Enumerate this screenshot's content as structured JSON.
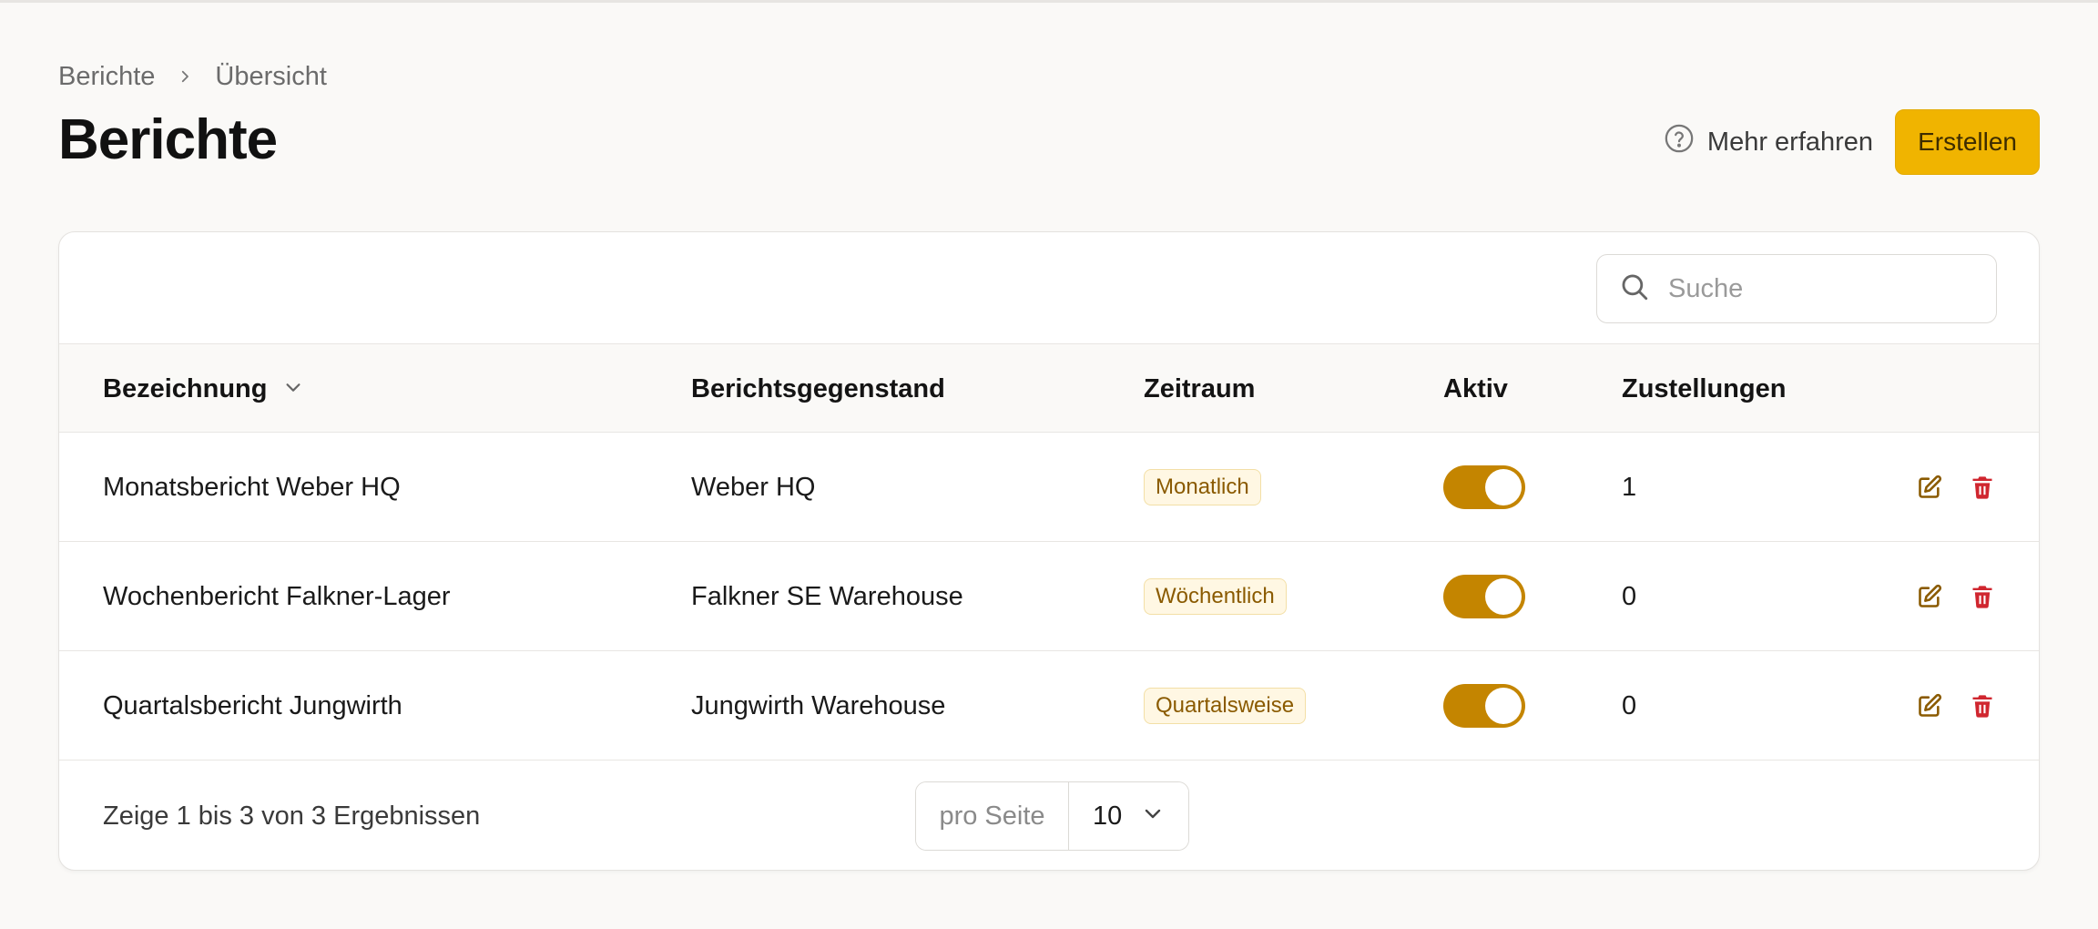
{
  "breadcrumb": {
    "items": [
      "Berichte",
      "Übersicht"
    ]
  },
  "page": {
    "title": "Berichte"
  },
  "header": {
    "learn_more": "Mehr erfahren",
    "create": "Erstellen"
  },
  "search": {
    "placeholder": "Suche"
  },
  "table": {
    "columns": [
      "Bezeichnung",
      "Berichtsgegenstand",
      "Zeitraum",
      "Aktiv",
      "Zustellungen"
    ],
    "rows": [
      {
        "name": "Monatsbericht Weber HQ",
        "subject": "Weber HQ",
        "period": "Monatlich",
        "active": true,
        "deliveries": "1"
      },
      {
        "name": "Wochenbericht Falkner-Lager",
        "subject": "Falkner SE Warehouse",
        "period": "Wöchentlich",
        "active": true,
        "deliveries": "0"
      },
      {
        "name": "Quartalsbericht Jungwirth",
        "subject": "Jungwirth Warehouse",
        "period": "Quartalsweise",
        "active": true,
        "deliveries": "0"
      }
    ]
  },
  "footer": {
    "results": "Zeige 1 bis 3 von 3 Ergebnissen",
    "per_page_label": "pro Seite",
    "per_page_value": "10"
  },
  "icons": {
    "learn_more": "question-circle-icon",
    "search": "search-icon",
    "sort": "chevron-down-icon",
    "edit": "edit-icon",
    "delete": "trash-icon"
  },
  "colors": {
    "accent": "#f0b400",
    "toggle_on": "#c48500",
    "edit": "#8a5a00",
    "delete": "#d0262f",
    "badge_bg": "#fff7e3"
  }
}
